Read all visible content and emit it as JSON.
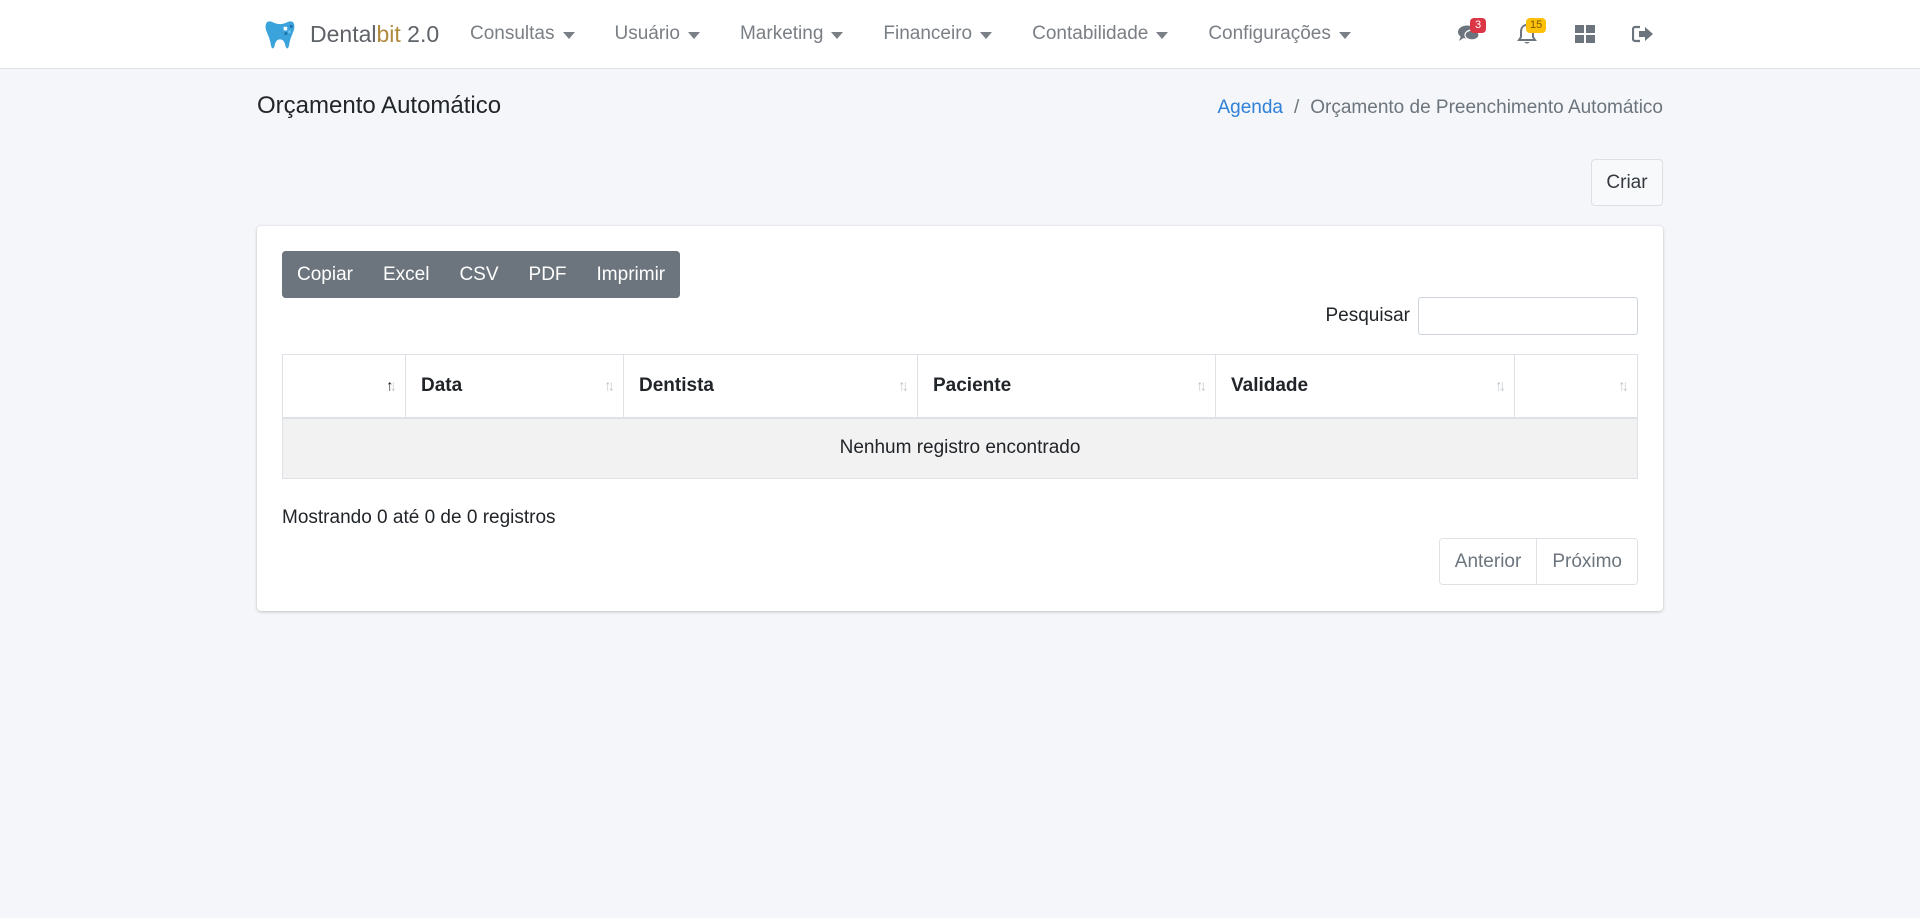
{
  "brand": {
    "name_prefix": "Dental",
    "name_highlight": "bit",
    "name_suffix": " 2.0"
  },
  "nav": {
    "menus": [
      {
        "label": "Consultas"
      },
      {
        "label": "Usuário"
      },
      {
        "label": "Marketing"
      },
      {
        "label": "Financeiro"
      },
      {
        "label": "Contabilidade"
      },
      {
        "label": "Configurações"
      }
    ],
    "icons": {
      "messages_count": "3",
      "notifications_count": "15"
    }
  },
  "page": {
    "title": "Orçamento Automático",
    "breadcrumb": {
      "link": "Agenda",
      "separator": "/",
      "current": "Orçamento de Preenchimento Automático"
    },
    "create_label": "Criar"
  },
  "table_tools": {
    "export_buttons": [
      "Copiar",
      "Excel",
      "CSV",
      "PDF",
      "Imprimir"
    ],
    "search_label": "Pesquisar",
    "search_value": ""
  },
  "table": {
    "columns": [
      "",
      "Data",
      "Dentista",
      "Paciente",
      "Validade",
      ""
    ],
    "empty_message": "Nenhum registro encontrado"
  },
  "footer": {
    "info": "Mostrando 0 até 0 de 0 registros",
    "prev_label": "Anterior",
    "next_label": "Próximo"
  },
  "colors": {
    "accent": "#2f80d8",
    "badge_red": "#dc3545",
    "badge_yellow": "#ffc107",
    "button_secondary": "#6c757d"
  }
}
